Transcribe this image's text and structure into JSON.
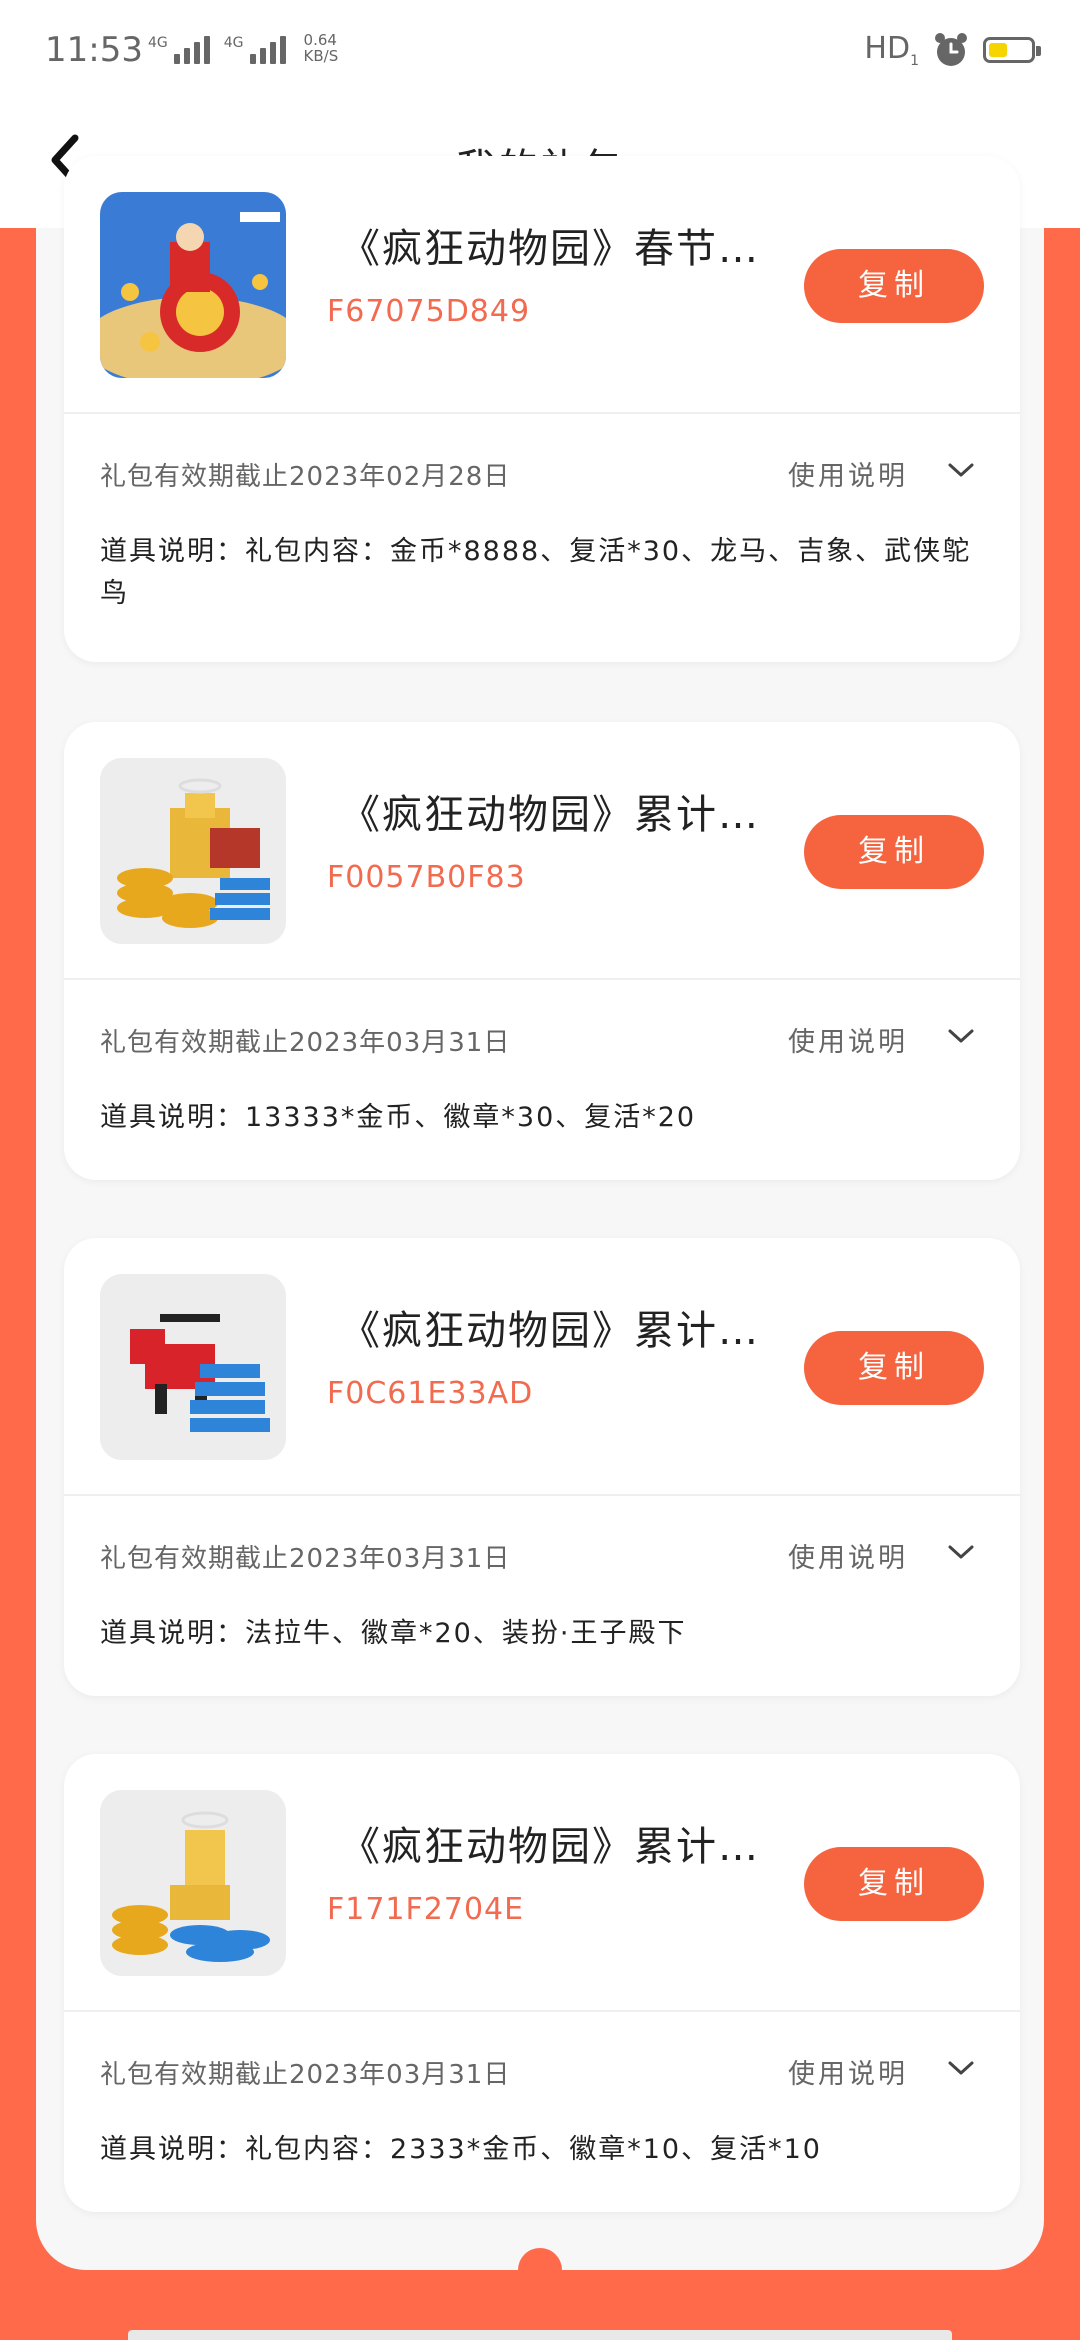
{
  "status_bar": {
    "time": "11:53",
    "signal1_label": "4G",
    "signal2_label": "4G",
    "speed_value": "0.64",
    "speed_unit": "KB/S",
    "hd": "HD",
    "hd_sub": "1",
    "battery_color": "#f5d400"
  },
  "header": {
    "title": "我的礼包",
    "back_icon": "chevron-left-icon"
  },
  "colors": {
    "accent": "#f5643f",
    "background": "#ff6a4a",
    "code_text": "#f26a4f"
  },
  "gifts": [
    {
      "title": "《疯狂动物园》春节…",
      "code": "F67075D849",
      "copy_label": "复制",
      "expire": "礼包有效期截止2023年02月28日",
      "usage_label": "使用说明",
      "desc": "道具说明：礼包内容：金币*8888、复活*30、龙马、吉象、武侠鸵鸟",
      "image": "festival-red-lion-drum-image"
    },
    {
      "title": "《疯狂动物园》累计…",
      "code": "F0057B0F83",
      "copy_label": "复制",
      "expire": "礼包有效期截止2023年03月31日",
      "usage_label": "使用说明",
      "desc": "道具说明：13333*金币、徽章*30、复活*20",
      "image": "gold-coins-treasure-chest-image"
    },
    {
      "title": "《疯狂动物园》累计…",
      "code": "F0C61E33AD",
      "copy_label": "复制",
      "expire": "礼包有效期截止2023年03月31日",
      "usage_label": "使用说明",
      "desc": "道具说明：法拉牛、徽章*20、装扮·王子殿下",
      "image": "red-bull-blue-badges-image"
    },
    {
      "title": "《疯狂动物园》累计…",
      "code": "F171F2704E",
      "copy_label": "复制",
      "expire": "礼包有效期截止2023年03月31日",
      "usage_label": "使用说明",
      "desc": "道具说明：礼包内容：2333*金币、徽章*10、复活*10",
      "image": "gold-coins-badges-image"
    }
  ]
}
